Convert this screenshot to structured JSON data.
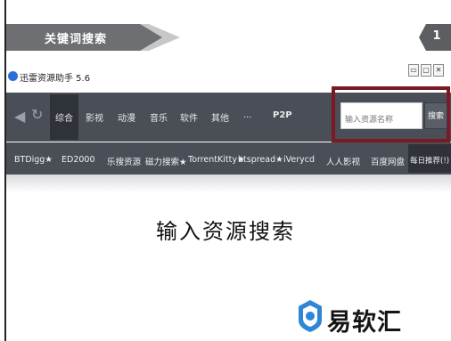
{
  "slide": {
    "title": "关键词搜索",
    "page_number": "1",
    "caption": "输入资源搜索"
  },
  "app": {
    "title": "迅雷资源助手 5.6",
    "window_buttons": [
      "▭",
      "▢",
      "✕"
    ],
    "categories": [
      "综合",
      "影视",
      "动漫",
      "音乐",
      "软件",
      "其他",
      "...",
      "P2P"
    ],
    "active_category": "综合",
    "search": {
      "placeholder": "输入资源名称",
      "button_label": "搜索"
    },
    "sites": [
      "BTDigg★",
      "ED2000",
      "乐搜资源",
      "磁力搜索★",
      "TorrentKitty★",
      "btspread★",
      "iVerycd",
      "人人影视",
      "百度网盘",
      "每日推荐(!)"
    ],
    "active_site": "每日推荐(!)"
  },
  "brand": {
    "name": "易软汇"
  },
  "colors": {
    "toolbar": "#4a4e57",
    "header_band": "#6d6f73",
    "highlight": "#7a1a22"
  }
}
